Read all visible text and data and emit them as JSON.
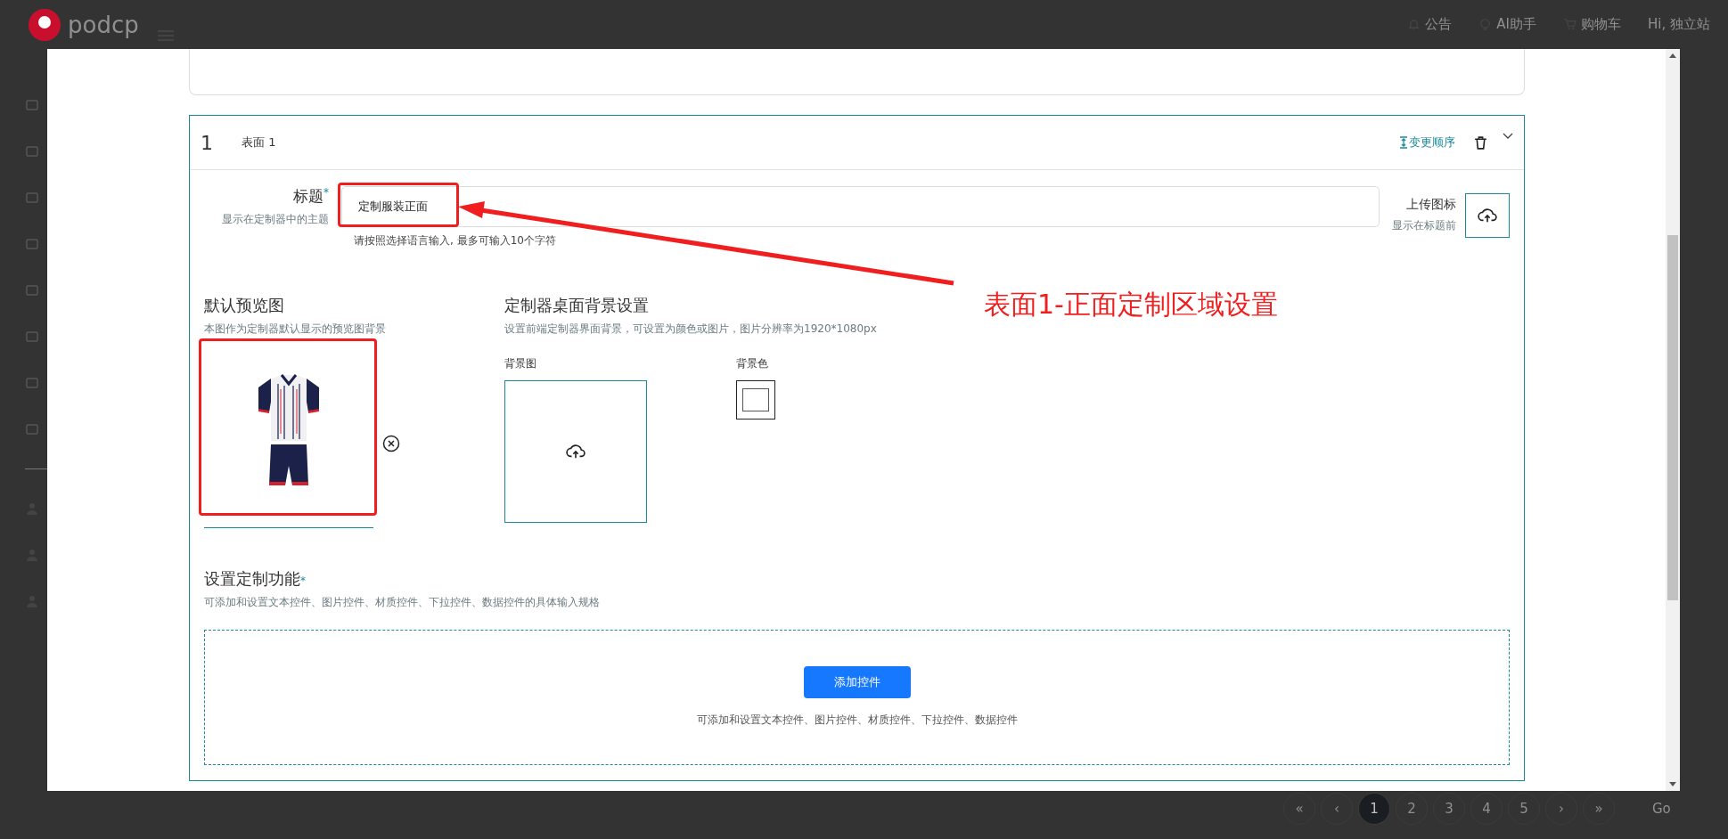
{
  "background_page": {
    "logo": "podcp",
    "header_links": [
      {
        "kind": "bell",
        "label": "公告"
      },
      {
        "kind": "bulb",
        "label": "AI助手"
      },
      {
        "kind": "cart",
        "label": "购物车"
      },
      {
        "kind": "user",
        "label": "Hi, 独立站"
      }
    ],
    "pagination": {
      "first": "«",
      "prev": "‹",
      "pages": [
        {
          "label": "1",
          "selected": true
        },
        {
          "label": "2",
          "selected": false
        },
        {
          "label": "3",
          "selected": false
        },
        {
          "label": "4",
          "selected": false
        },
        {
          "label": "5",
          "selected": false
        }
      ],
      "next": "›",
      "last": "»",
      "go": "Go"
    }
  },
  "surface": {
    "index": "1",
    "name": "表面 1",
    "reorder": "变更顺序",
    "title_field": {
      "label": "标题",
      "required_mark": "*",
      "hint": "显示在定制器中的主题",
      "value": "定制服装正面",
      "note": "请按照选择语言输入, 最多可输入10个字符"
    },
    "icon_upload": {
      "label": "上传图标",
      "hint": "显示在标题前"
    },
    "preview": {
      "title": "默认预览图",
      "description": "本图作为定制器默认显示的预览图背景"
    },
    "background": {
      "title": "定制器桌面背景设置",
      "description": "设置前端定制器界面背景，可设置为颜色或图片，图片分辨率为1920*1080px",
      "image_label": "背景图",
      "color_label": "背景色"
    },
    "features": {
      "title": "设置定制功能",
      "required_mark": "*",
      "description": "可添加和设置文本控件、图片控件、材质控件、下拉控件、数据控件的具体输入规格",
      "button": "添加控件",
      "empty_text": "可添加和设置文本控件、图片控件、材质控件、下拉控件、数据控件"
    }
  },
  "annotation": {
    "text": "表面1-正面定制区域设置"
  }
}
